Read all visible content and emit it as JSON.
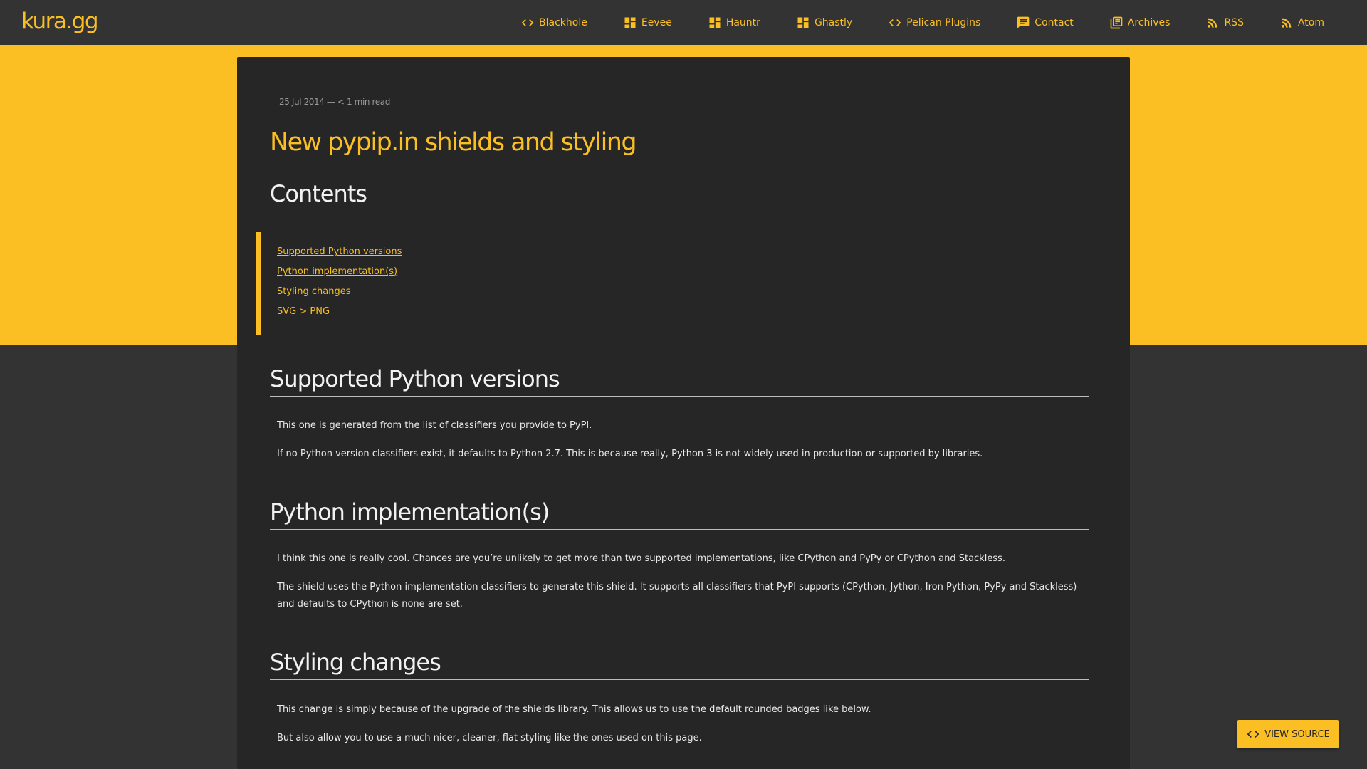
{
  "header": {
    "brand": "kura.gg",
    "nav": [
      {
        "label": "Blackhole",
        "icon": "code-icon"
      },
      {
        "label": "Eevee",
        "icon": "dashboard-icon"
      },
      {
        "label": "Hauntr",
        "icon": "dashboard-icon"
      },
      {
        "label": "Ghastly",
        "icon": "dashboard-icon"
      },
      {
        "label": "Pelican Plugins",
        "icon": "code-icon"
      },
      {
        "label": "Contact",
        "icon": "chat-icon"
      },
      {
        "label": "Archives",
        "icon": "library-books-icon"
      },
      {
        "label": "RSS",
        "icon": "rss-icon"
      },
      {
        "label": "Atom",
        "icon": "rss-icon"
      }
    ]
  },
  "colors": {
    "accent": "#fbbf24",
    "background": "#333333",
    "card": "#262626",
    "text": "#eaeaea"
  },
  "post": {
    "meta": "25 Jul 2014 — < 1 min read",
    "title": "New pypip.in shields and styling",
    "contents_heading": "Contents",
    "toc": [
      "Supported Python versions",
      "Python implementation(s)",
      "Styling changes",
      "SVG > PNG"
    ],
    "sections": [
      {
        "heading": "Supported Python versions",
        "paragraphs": [
          "This one is generated from the list of classifiers you provide to PyPI.",
          "If no Python version classifiers exist, it defaults to Python 2.7. This is because really, Python 3 is not widely used in production or supported by libraries."
        ]
      },
      {
        "heading": "Python implementation(s)",
        "paragraphs": [
          "I think this one is really cool. Chances are you’re unlikely to get more than two supported implementations, like CPython and PyPy or CPython and Stackless.",
          "The shield uses the Python implementation classifiers to generate this shield. It supports all classifiers that PyPI supports (CPython, Jython, Iron Python, PyPy and Stackless) and defaults to CPython is none are set."
        ]
      },
      {
        "heading": "Styling changes",
        "paragraphs": [
          "This change is simply because of the upgrade of the shields library. This allows us to use the default rounded badges like below.",
          "But also allow you to use a much nicer, cleaner, flat styling like the ones used on this page."
        ]
      }
    ]
  },
  "view_source": {
    "label": "VIEW SOURCE",
    "icon": "code-icon"
  }
}
